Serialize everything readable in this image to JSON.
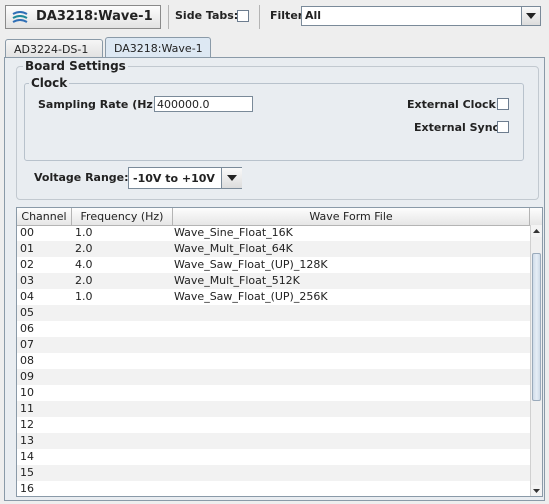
{
  "app": {
    "title": "DA3218:Wave-1"
  },
  "toolbar": {
    "side_tabs_label": "Side Tabs:",
    "filter_label": "Filter:",
    "filter_value": "All"
  },
  "tabs": [
    {
      "label": "AD3224-DS-1",
      "active": false
    },
    {
      "label": "DA3218:Wave-1",
      "active": true
    }
  ],
  "board_settings": {
    "title": "Board Settings",
    "clock": {
      "title": "Clock",
      "sampling_rate_label": "Sampling Rate (Hz):",
      "sampling_rate_value": "400000.0",
      "external_clock_label": "External Clock:",
      "external_sync_label": "External Sync:"
    },
    "voltage_range_label": "Voltage Range:",
    "voltage_range_value": "-10V to +10V"
  },
  "table": {
    "columns": [
      "Channel",
      "Frequency (Hz)",
      "Wave Form File"
    ],
    "rows": [
      [
        "00",
        "1.0",
        "Wave_Sine_Float_16K"
      ],
      [
        "01",
        "2.0",
        "Wave_Mult_Float_64K"
      ],
      [
        "02",
        "4.0",
        "Wave_Saw_Float_(UP)_128K"
      ],
      [
        "03",
        "2.0",
        "Wave_Mult_Float_512K"
      ],
      [
        "04",
        "1.0",
        "Wave_Saw_Float_(UP)_256K"
      ],
      [
        "05",
        "",
        ""
      ],
      [
        "06",
        "",
        ""
      ],
      [
        "07",
        "",
        ""
      ],
      [
        "08",
        "",
        ""
      ],
      [
        "09",
        "",
        ""
      ],
      [
        "10",
        "",
        ""
      ],
      [
        "11",
        "",
        ""
      ],
      [
        "12",
        "",
        ""
      ],
      [
        "13",
        "",
        ""
      ],
      [
        "14",
        "",
        ""
      ],
      [
        "15",
        "",
        ""
      ],
      [
        "16",
        "",
        ""
      ]
    ]
  },
  "icons": {
    "app_logo": "app-logo-icon",
    "dropdown": "chevron-down-icon",
    "scroll_up": "arrow-up-icon",
    "scroll_down": "arrow-down-icon"
  },
  "colors": {
    "panel_bg": "#e9edf1",
    "active_tab_bg": "#dde8f3",
    "border": "#8a9aa8"
  }
}
